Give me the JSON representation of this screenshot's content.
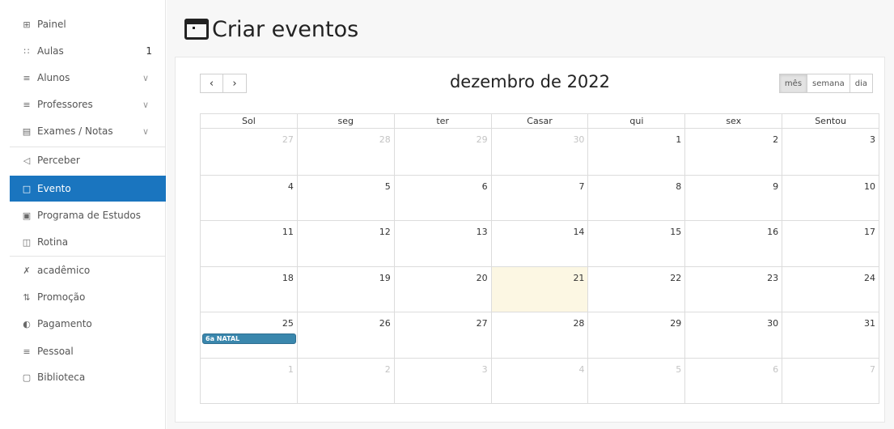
{
  "sidebar": {
    "items": [
      {
        "label": "Painel",
        "icon": "grid-icon",
        "glyph": "⊞"
      },
      {
        "label": "Aulas",
        "icon": "hierarchy-icon",
        "glyph": "∷",
        "badge": "1"
      },
      {
        "label": "Alunos",
        "icon": "users-icon",
        "glyph": "≡"
      },
      {
        "label": "Professores",
        "icon": "users-icon",
        "glyph": "≡"
      },
      {
        "label": "Exames / Notas",
        "icon": "document-icon",
        "glyph": "▤"
      },
      {
        "label": "Perceber",
        "icon": "megaphone-icon",
        "glyph": "◁"
      },
      {
        "label": "Evento",
        "icon": "calendar-icon",
        "glyph": "□"
      },
      {
        "label": "Programa de Estudos",
        "icon": "syllabus-icon",
        "glyph": "▣"
      },
      {
        "label": "Rotina",
        "icon": "routine-icon",
        "glyph": "◫"
      },
      {
        "label": "acadêmico",
        "icon": "tools-icon",
        "glyph": "✗"
      },
      {
        "label": "Promoção",
        "icon": "promotion-icon",
        "glyph": "⇅"
      },
      {
        "label": "Pagamento",
        "icon": "payment-icon",
        "glyph": "◐"
      },
      {
        "label": "Pessoal",
        "icon": "staff-icon",
        "glyph": "≡"
      },
      {
        "label": "Biblioteca",
        "icon": "book-icon",
        "glyph": "▢"
      }
    ]
  },
  "header": {
    "title": "Criar eventos"
  },
  "calendar": {
    "title": "dezembro de 2022",
    "prev_label": "‹",
    "next_label": "›",
    "views": [
      "mês",
      "semana",
      "dia"
    ],
    "active_view": "mês",
    "weekdays": [
      "Sol",
      "seg",
      "ter",
      "Casar",
      "qui",
      "sex",
      "Sentou"
    ],
    "weeks": [
      [
        "27",
        "28",
        "29",
        "30",
        "1",
        "2",
        "3"
      ],
      [
        "4",
        "5",
        "6",
        "7",
        "8",
        "9",
        "10"
      ],
      [
        "11",
        "12",
        "13",
        "14",
        "15",
        "16",
        "17"
      ],
      [
        "18",
        "19",
        "20",
        "21",
        "22",
        "23",
        "24"
      ],
      [
        "25",
        "26",
        "27",
        "28",
        "29",
        "30",
        "31"
      ],
      [
        "1",
        "2",
        "3",
        "4",
        "5",
        "6",
        "7"
      ]
    ],
    "today": "21",
    "events": [
      {
        "label": "6a NATAL",
        "date": "25",
        "color": "#3a87ad"
      }
    ]
  }
}
